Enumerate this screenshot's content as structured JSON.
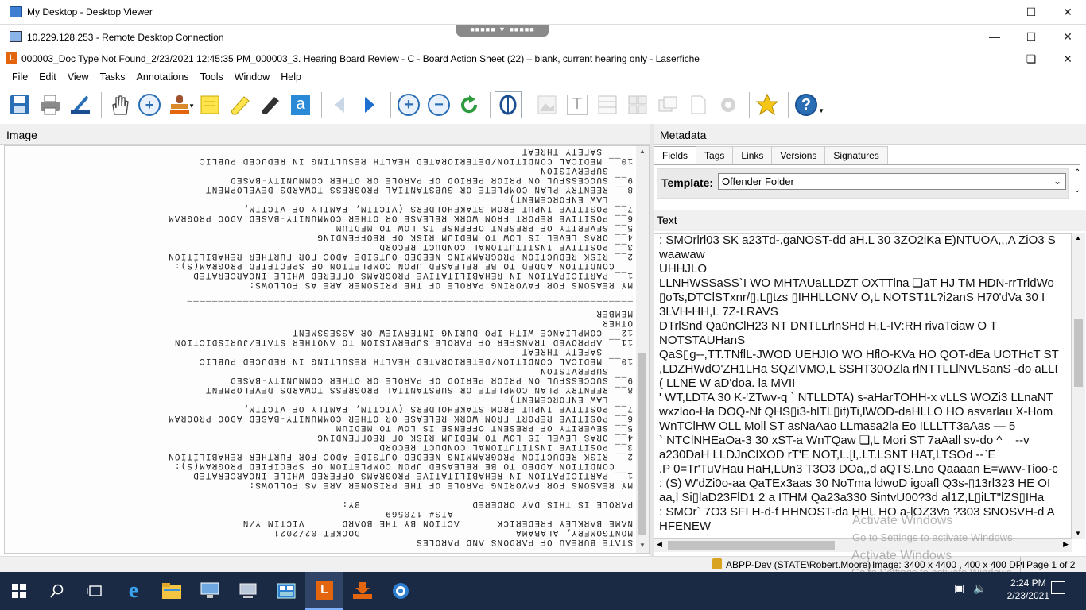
{
  "outer_window": {
    "title": "My Desktop - Desktop Viewer"
  },
  "rdp_window": {
    "title": "10.229.128.253 - Remote Desktop Connection"
  },
  "app_window": {
    "title": "000003_Doc Type Not Found_2/23/2021 12:45:35 PM_000003_3. Hearing Board Review - C - Board Action Sheet (22) – blank, current hearing only - Laserfiche"
  },
  "menu": [
    "File",
    "Edit",
    "View",
    "Tasks",
    "Annotations",
    "Tools",
    "Window",
    "Help"
  ],
  "panes": {
    "image_label": "Image",
    "metadata_label": "Metadata",
    "text_label": "Text"
  },
  "tabs": [
    "Fields",
    "Tags",
    "Links",
    "Versions",
    "Signatures"
  ],
  "template": {
    "label": "Template:",
    "value": "Offender Folder"
  },
  "document_lines": [
    "STATE BUREAU OF PARDONS AND PAROLES",
    "MONTGOMERY, ALABAMA                         DOCKET 02/2021",
    "NAME BARKLEY FREDERICK      ACTION BY THE BOARD      VICTIM Y/N",
    "                             AIS# 170569",
    "PAROLE IS THIS DAY ORDERED                  BY:",
    "",
    "MY REASONS FOR FAVORING PAROLE OF THE PRISONER ARE AS FOLLOWS:",
    "1__ PARTICIPATION IN REHABILITATIVE PROGRAMS OFFERED WHILE INCARCERATED",
    "   CONDITION ADDED TO BE RELEASED UPON COMPLETION OF SPECIFIED PROGRAM(S):",
    "2__ RISK REDUCTION PROGRAMMING NEEDED OUTSIDE ADOC FOR FURTHER REHABILITION",
    "3__ POSITIVE INSTITUTIONAL CONDUCT RECORD",
    "4__ ORAS LEVEL IS LOW TO MEDIUM RISK OF REOFFENDING",
    "5__ SEVERITY OF PRESENT OFFENSE IS LOW TO MEDIUM",
    "6__ POSITIVE REPORT FROM WORK RELEASE OR OTHER COMMUNITY-BASED ADOC PROGRAM",
    "7__ POSITIVE INPUT FROM STAKEHOLDERS (VICTIM, FAMILY OF VICTIM,",
    "    LAW ENFORCEMENT)",
    "8__ REENTRY PLAN COMPLETE OR SUBSTANTIAL PROGRESS TOWARDS DEVELOPMENT",
    "9__ SUCCESSFUL ON PRIOR PERIOD OF PAROLE OR OTHER COMMUNITY-BASED",
    "    SUPERVISION",
    "10__ MEDICAL CONDITION/DETERIORATED HEALTH RESULTING IN REDUCED PUBLIC",
    "     SAFETY THREAT",
    "11__ APPROVED TRANSFER OF PAROLE SUPERVISION TO ANOTHER STATE/JURISDICTION",
    "12__ COMPLIANCE WITH IPO DURING INTERVIEW OR ASSESSMENT",
    "OTHER",
    "MEMBER",
    "________________________________________________________________________",
    "",
    "MY REASONS FOR FAVORING PAROLE OF THE PRISONER ARE AS FOLLOWS:",
    "1__ PARTICIPATION IN REHABILITATIVE PROGRAMS OFFERED WHILE INCARCERATED",
    "   CONDITION ADDED TO BE RELEASED UPON COMPLETION OF SPECIFIED PROGRAM(S):",
    "2__ RISK REDUCTION PROGRAMMING NEEDED OUTSIDE ADOC FOR FURTHER REHABILITION",
    "3__ POSITIVE INSTITUTIONAL CONDUCT RECORD",
    "4__ ORAS LEVEL IS LOW TO MEDIUM RISK OF REOFFENDING",
    "5__ SEVERITY OF PRESENT OFFENSE IS LOW TO MEDIUM",
    "6__ POSITIVE REPORT FROM WORK RELEASE OR OTHER COMMUNITY-BASED ADOC PROGRAM",
    "7__ POSITIVE INPUT FROM STAKEHOLDERS (VICTIM, FAMILY OF VICTIM,",
    "    LAW ENFORCEMENT)",
    "8__ REENTRY PLAN COMPLETE OR SUBSTANTIAL PROGRESS TOWARDS DEVELOPMENT",
    "9__ SUCCESSFUL ON PRIOR PERIOD OF PAROLE OR OTHER COMMUNITY-BASED",
    "    SUPERVISION",
    "10__ MEDICAL CONDITION/DETERIORATED HEALTH RESULTING IN REDUCED PUBLIC",
    "     SAFETY THREAT"
  ],
  "ocr_text": [
    ": SMOrlrl03 SK a23Td-,gaNOST-dd aH.L 30 3ZO2iKa E)NTUOA,,,A ZiO3 S",
    "waawaw",
    "UHHJLO",
    "LLNHWSSaSS`I WO MHTAUaLLDZT OXTTlna ❏aТ HJ TM HDN-rrTrldWo",
    "▯oTs,DTClSTxnr/▯,L▯tzs ▯IHHLLONV O,L NOTST1L?i2anS H70'dVa 30 I",
    "3LVH-HH,L 7Z-LRAVS",
    "DTrlSnd Qa0nClH23 NT DNTLLrlnSHd H,L-IV:RH rivaTciaw O T",
    "NOTSTAUHanS",
    "QaS▯g--,TT.TNflL-JWOD UEHJIO WO HflO-KVa HO QOT-dEa UOTHcT ST",
    ",LDZHWdO'ZH1LHa SQZIVMO,L SSHT30OZla rlNTTLLlNVLSanS -do aLLI",
    "( LLNE W aD'doa. la MVII",
    "' WT,LDTA 30 K-'ZTwv-q ` NTLLDTA) s-aHarTOHH-x vLLS WOZi3 LLnaNT",
    "wxzloo-Ha DOQ-Nf QHS▯i3-hlTL▯if)Ti,lWOD-daHLLO HO asvarlau X-Hom",
    "WnTClHW OLL Moll ST asNaAao LLmasa2la Eo ILLLTT3aAas — 5",
    "` NTClNHEaOa-3 30 xST-a WnTQaw ❏,L Mori ST 7aAall sv-do ^__--v",
    "a230DaH LLDJnClXOD rT'E NOT,L.[l,.LT.LSNT HAT,LTSOd --`E",
    ".P 0=Tr'TuVHau HaH,LUn3 T3O3 DOa,,d aQTS.Lno Qaaaan E=wwv-Tioo-c",
    ": (S) W'dZi0o-aa QaTEx3aas 30 NoTma ldwoD igoafl Q3s-▯13rl323 HE OI",
    "aa,l Si▯laD23FlD1 2 a ITHM Qa23a330 SintvU00?3d al1Z,L▯iLT\"lZS▯IHa",
    ": SMOr` 7O3 SFI H-d-f HHNOST-da HHL HO a-lOZ3Va ?303 SNOSVH-d A",
    "HFENEW"
  ],
  "watermark": {
    "line1": "Activate Windows",
    "line2": "Go to Settings to activate Windows."
  },
  "status": {
    "user": "ABPP-Dev (STATE\\Robert.Moore)",
    "image": "Image: 3400 x 4400 , 400 x 400 DPI",
    "page": "Page 1 of 2"
  },
  "clock": {
    "time": "2:24 PM",
    "date": "2/23/2021"
  },
  "icons": [
    "save-icon",
    "print-icon",
    "scanner-icon",
    "pan-hand-icon",
    "zoom-in-icon",
    "stamp-icon",
    "sticky-note-icon",
    "highlighter-icon",
    "pen-icon",
    "text-annotation-icon",
    "prev-page-icon",
    "next-page-icon",
    "zoom-in-icon",
    "zoom-out-icon",
    "refresh-icon",
    "ocr-icon",
    "thumbnail-icon",
    "text-pane-icon",
    "metadata-pane-icon",
    "star-icon",
    "help-icon"
  ],
  "colors": {
    "accent": "#2a6fb5",
    "laserfiche_orange": "#e3660e",
    "taskbar": "#1b2a44"
  }
}
